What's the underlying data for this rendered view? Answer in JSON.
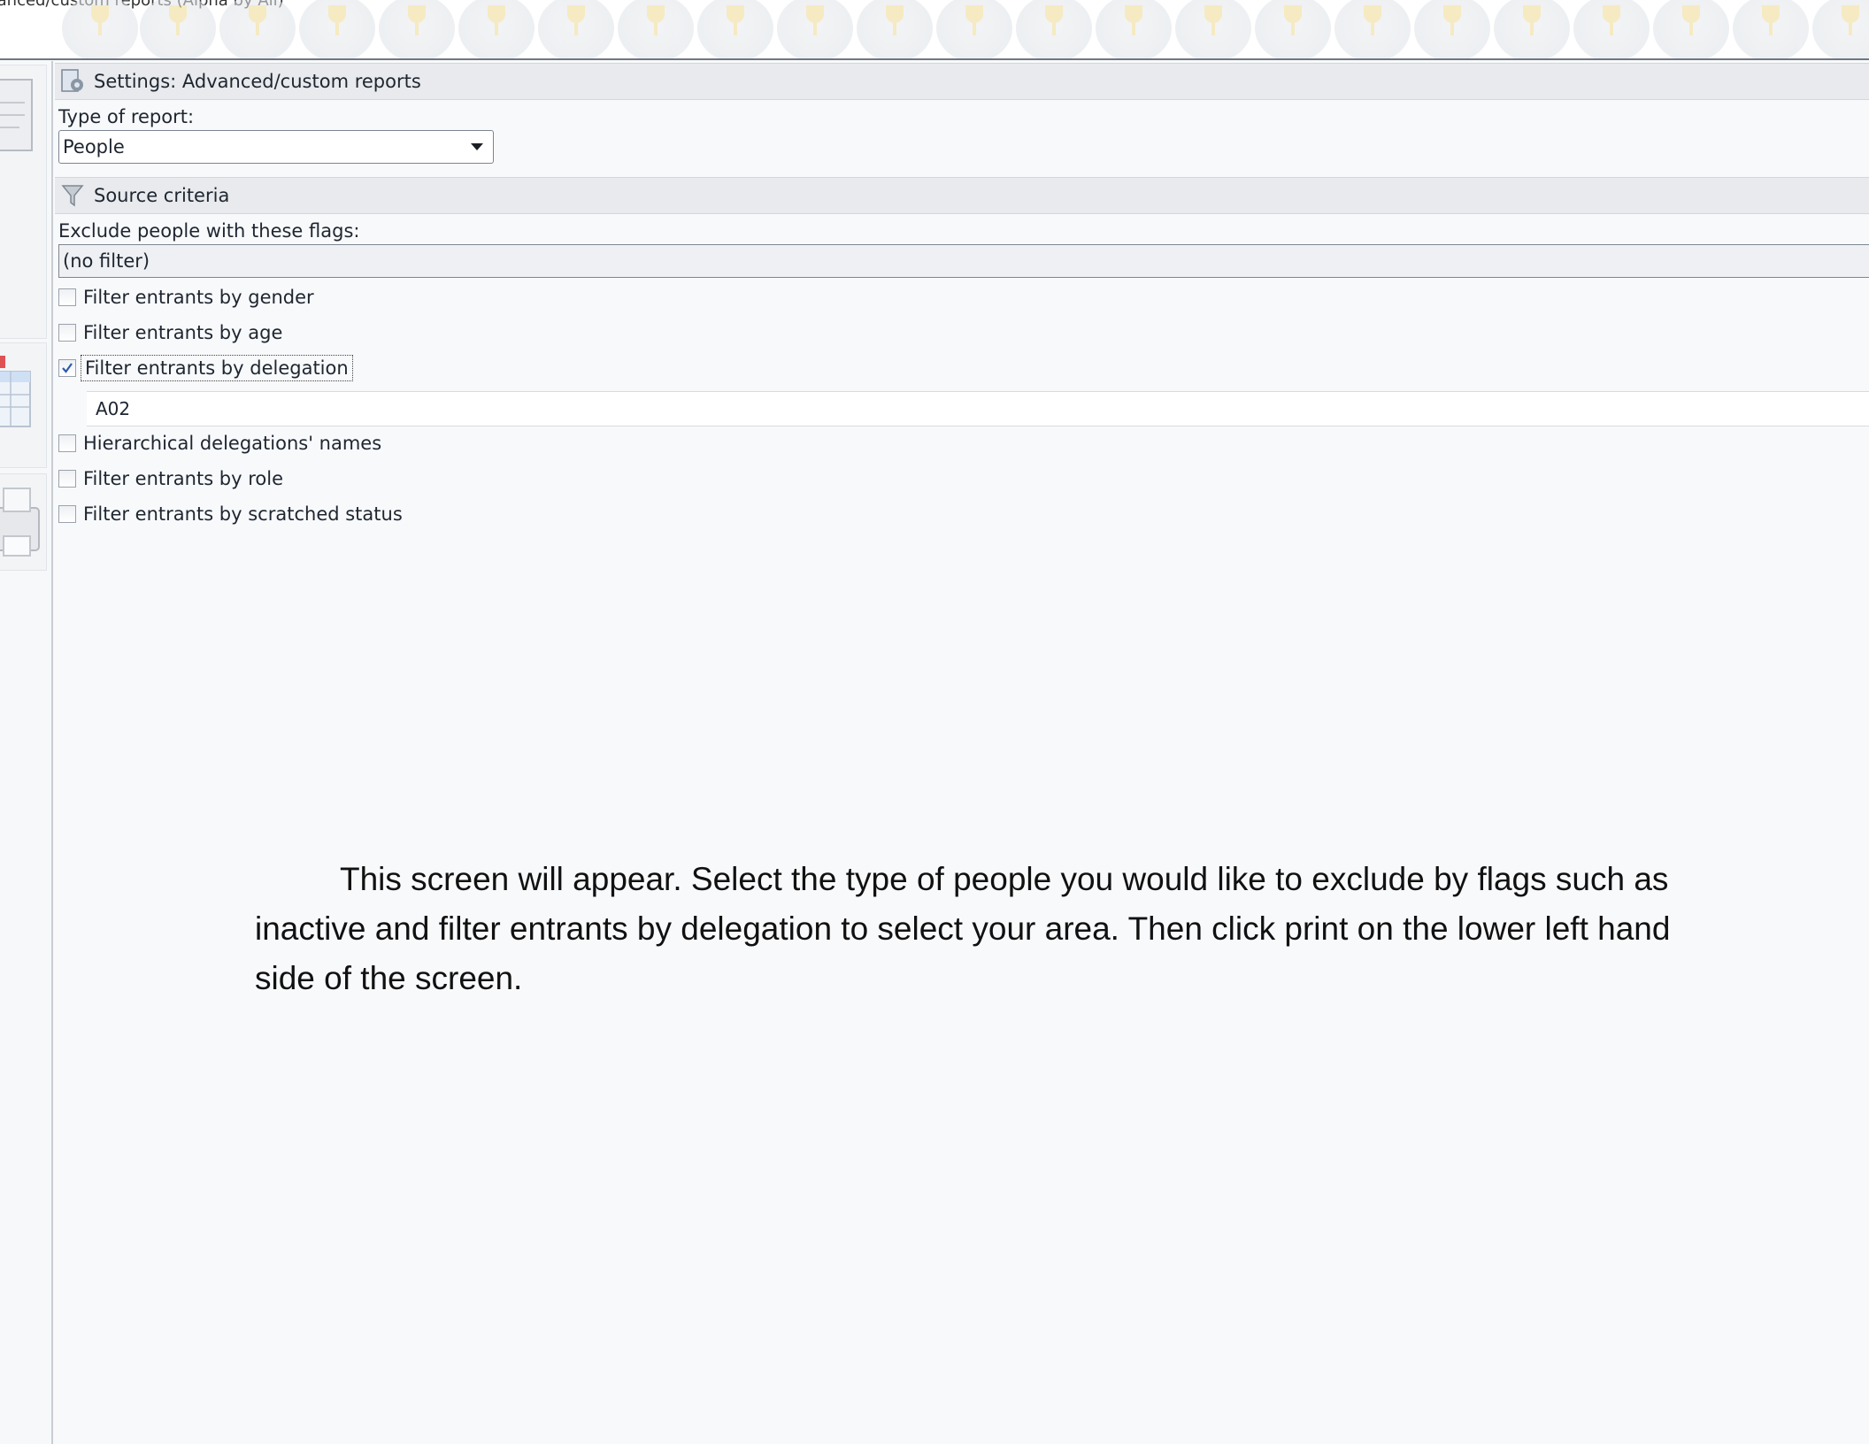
{
  "banner": {
    "title": "vanced/custom reports (Alpha by All)"
  },
  "panel": {
    "header": "Settings: Advanced/custom reports",
    "report_type_label": "Type of report:",
    "report_type_value": "People",
    "source_header": "Source criteria",
    "exclude_label": "Exclude people with these flags:",
    "exclude_value": "(no filter)",
    "delegation_value": "A02",
    "filters": [
      {
        "label": "Filter entrants by gender",
        "checked": false
      },
      {
        "label": "Filter entrants by age",
        "checked": false
      },
      {
        "label": "Filter entrants by delegation",
        "checked": true
      },
      {
        "label": "Hierarchical delegations' names",
        "checked": false
      },
      {
        "label": "Filter entrants by role",
        "checked": false
      },
      {
        "label": "Filter entrants by scratched status",
        "checked": false
      }
    ]
  },
  "instructions": "This screen will appear. Select the type of people you would like to exclude by flags such as inactive and filter entrants by delegation to select your area. Then click print on the lower left hand side of the screen.",
  "icons": {
    "settings": "settings-report-icon",
    "source": "funnel-icon",
    "dropdown": "chevron-down-icon"
  },
  "colors": {
    "header_bg": "#e8eaed",
    "banner_line": "#6e7781",
    "check_mark": "#2a5caa"
  }
}
